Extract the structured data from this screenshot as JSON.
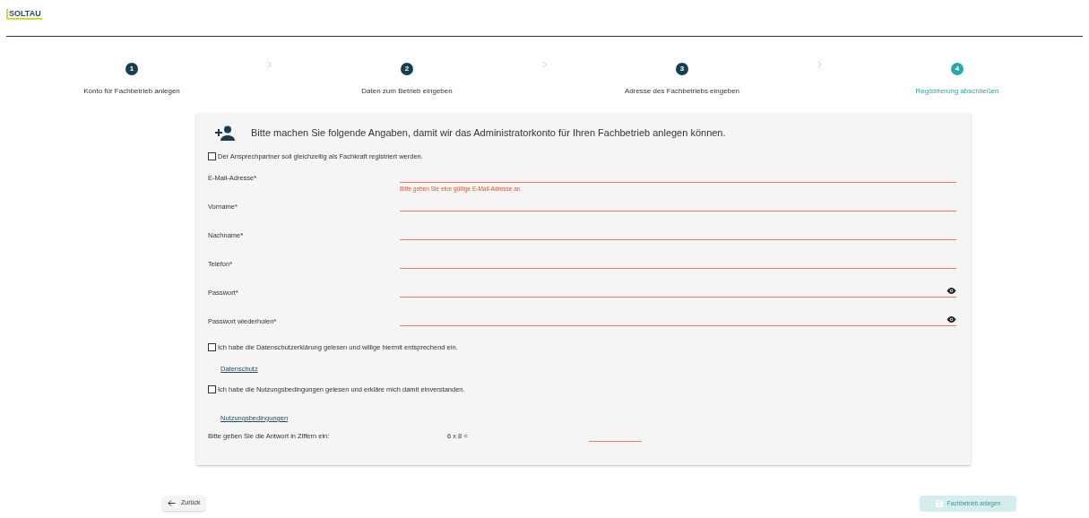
{
  "logo": {
    "text": "SOLTAU"
  },
  "steps": [
    {
      "number": "1",
      "label": "Konto für Fachbetrieb anlegen",
      "selected": false
    },
    {
      "number": "2",
      "label": "Daten zum Betrieb eingeben",
      "selected": false
    },
    {
      "number": "3",
      "label": "Adresse des Fachbetriebs eingeben",
      "selected": false
    },
    {
      "number": "4",
      "label": "Registrierung abschließen",
      "selected": true
    }
  ],
  "form": {
    "heading": "Bitte machen Sie folgende Angaben, damit wir das Administratorkonto für Ihren Fachbetrieb anlegen können.",
    "contact_checkbox": {
      "label": "Der Ansprechpartner soll gleichzeitig als Fachkraft registriert werden.",
      "checked": false
    },
    "fields": [
      {
        "label": "E-Mail-Adresse*",
        "error": "Bitte geben Sie eine gültige E-Mail-Adresse an.",
        "kind": "text"
      },
      {
        "label": "Vorname*",
        "kind": "text"
      },
      {
        "label": "Nachname*",
        "kind": "text"
      },
      {
        "label": "Telefon*",
        "kind": "text"
      },
      {
        "label": "Passwort*",
        "kind": "password"
      },
      {
        "label": "Passwort wiederholen*",
        "kind": "password"
      }
    ],
    "consents": [
      {
        "label": "Ich habe die Datenschutzerklärung gelesen und willige hiermit entsprechend ein.",
        "checked": false,
        "link": "Datenschutz"
      },
      {
        "label": "Ich habe die Nutzungsbedingungen gelesen und erkläre mich damit einverstanden.",
        "checked": false,
        "link": "Nutzungsbedingungen"
      }
    ],
    "captcha": {
      "prompt": "Bitte geben Sie die Antwort in Ziffern ein:",
      "question": "6 x 8 ="
    }
  },
  "buttons": {
    "back": {
      "label": "Zurück"
    },
    "submit": {
      "label": "Fachbetrieb anlegen",
      "disabled": true
    }
  }
}
